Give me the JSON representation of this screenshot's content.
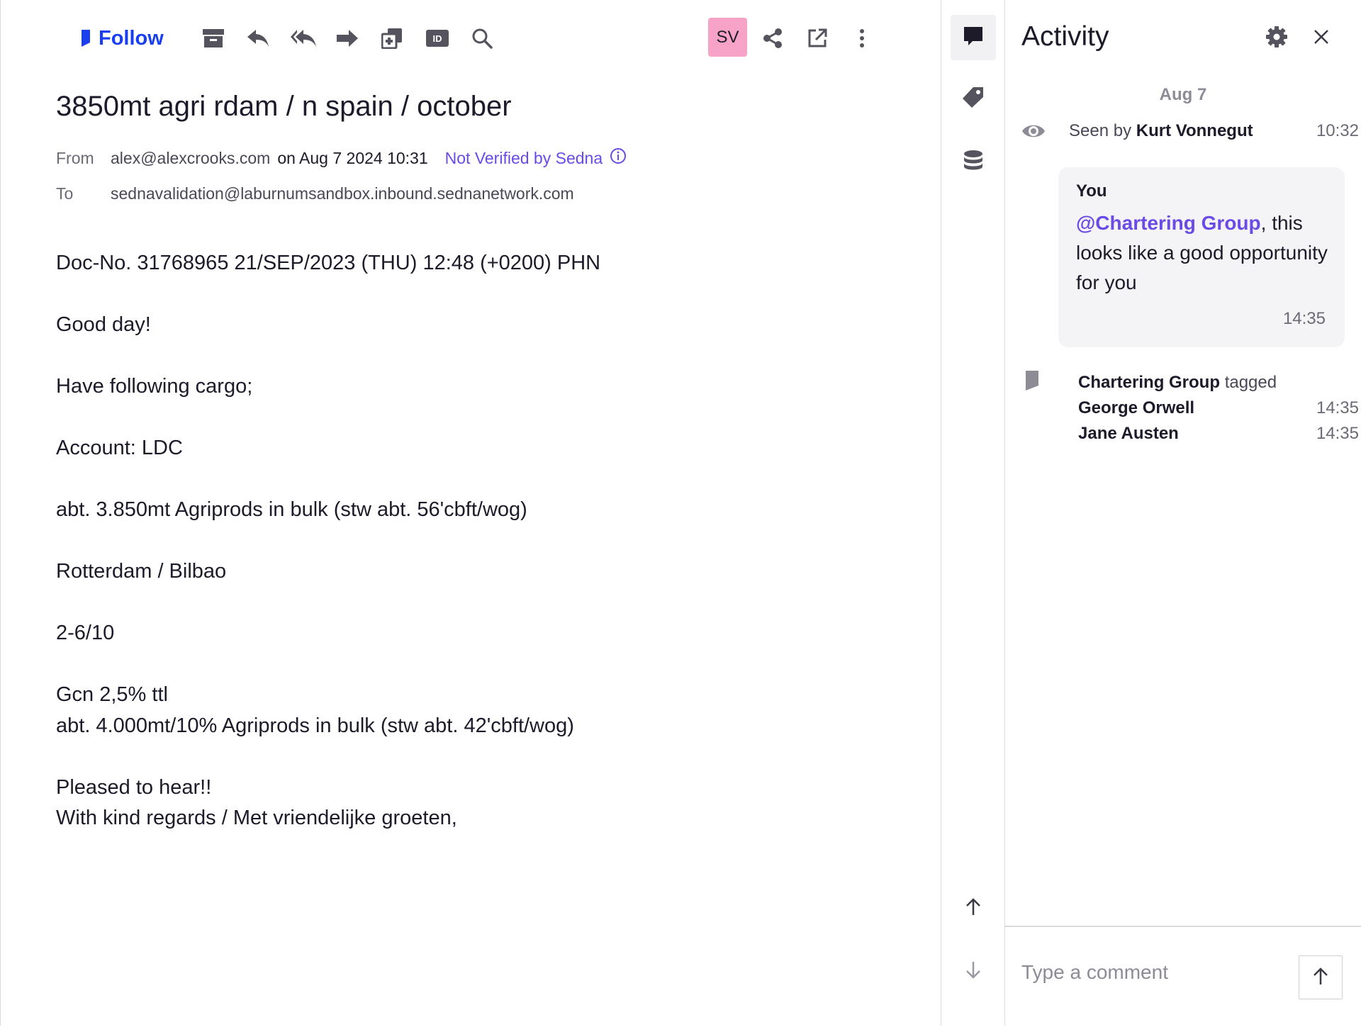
{
  "toolbar": {
    "follow_label": "Follow",
    "icons": [
      "archive-icon",
      "reply-icon",
      "reply-all-icon",
      "forward-icon",
      "add-copy-icon",
      "id-icon",
      "search-icon"
    ],
    "avatar_initials": "SV",
    "avatar_color": "#f7a3c8",
    "right_icons": [
      "share-icon",
      "external-link-icon",
      "more-icon"
    ]
  },
  "email": {
    "subject": "3850mt agri rdam / n spain / october",
    "from_label": "From",
    "from_address": "alex@alexcrooks.com",
    "date": "on Aug 7 2024 10:31",
    "verification": "Not Verified by Sedna",
    "to_label": "To",
    "to_address": "sednavalidation@laburnumsandbox.inbound.sednanetwork.com",
    "body_lines": [
      "Doc-No. 31768965 21/SEP/2023 (THU) 12:48 (+0200) PHN",
      "",
      "Good day!",
      "",
      "Have following cargo;",
      "",
      "Account: LDC",
      "",
      "abt. 3.850mt Agriprods in bulk (stw abt. 56'cbft/wog)",
      "",
      "Rotterdam / Bilbao",
      "",
      "2-6/10",
      "",
      "Gcn 2,5% ttl",
      "abt. 4.000mt/10% Agriprods in bulk (stw abt. 42'cbft/wog)",
      "",
      "Pleased to hear!!",
      "With kind regards / Met vriendelijke groeten,"
    ]
  },
  "rail": {
    "top_icons": [
      "comment-icon",
      "tag-icon",
      "database-icon"
    ],
    "bottom_icons": [
      "arrow-up-icon",
      "arrow-down-icon"
    ]
  },
  "activity": {
    "title": "Activity",
    "date_separator": "Aug 7",
    "seen": {
      "prefix": "Seen by",
      "name": "Kurt Vonnegut",
      "time": "10:32"
    },
    "comment": {
      "author": "You",
      "mention": "@Chartering Group",
      "text": ", this looks like a good opportunity for you",
      "time": "14:35"
    },
    "tag_event": {
      "group": "Chartering Group",
      "verb": "tagged",
      "people": [
        {
          "name": "George Orwell",
          "time": "14:35"
        },
        {
          "name": "Jane Austen",
          "time": "14:35"
        }
      ]
    },
    "composer": {
      "placeholder": "Type a comment"
    }
  },
  "colors": {
    "accent": "#6b4be6",
    "follow_blue": "#1a3ff0",
    "text": "#1d1b2a",
    "muted": "#6b6a75"
  }
}
